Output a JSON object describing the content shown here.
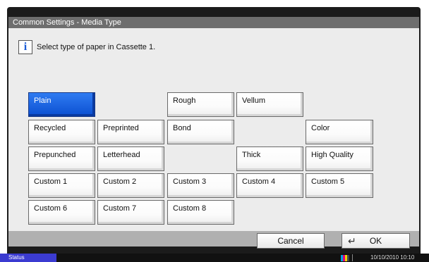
{
  "window": {
    "title": "Common Settings - Media Type"
  },
  "info": {
    "icon": "info-icon",
    "glyph": "i",
    "message": "Select type of paper in Cassette 1."
  },
  "media_types": {
    "plain": "Plain",
    "rough": "Rough",
    "vellum": "Vellum",
    "recycled": "Recycled",
    "preprinted": "Preprinted",
    "bond": "Bond",
    "color": "Color",
    "prepunched": "Prepunched",
    "letterhead": "Letterhead",
    "thick": "Thick",
    "high_quality": "High Quality",
    "custom1": "Custom 1",
    "custom2": "Custom 2",
    "custom3": "Custom 3",
    "custom4": "Custom 4",
    "custom5": "Custom 5",
    "custom6": "Custom 6",
    "custom7": "Custom 7",
    "custom8": "Custom 8",
    "selected": "Plain"
  },
  "footer": {
    "cancel_label": "Cancel",
    "ok_label": "OK",
    "ok_icon": "enter-icon"
  },
  "statusbar": {
    "status_label": "Status",
    "datetime": "10/10/2010 10:10",
    "toner_icon": "toner-level-icon",
    "toner_colors": [
      "#00a0e0",
      "#e0007a",
      "#f0d000",
      "#222222"
    ]
  },
  "colors": {
    "selected": "#1a5fe0",
    "titlebar": "#6e6e6e",
    "frame": "#1b1b1b",
    "status": "#3b3bd1"
  }
}
